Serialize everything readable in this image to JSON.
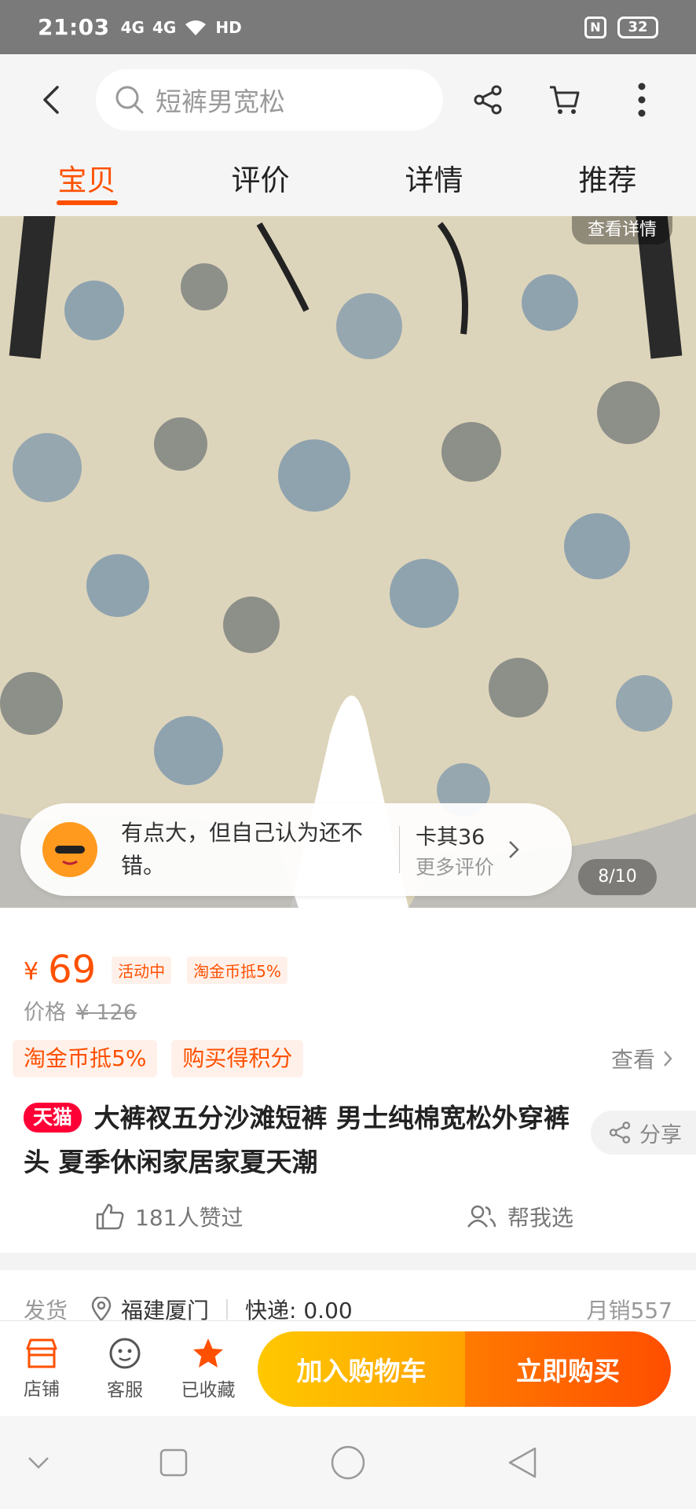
{
  "status_bar": {
    "time": "21:03",
    "signal_1": "4G",
    "signal_2": "4G",
    "hd": "HD",
    "nfc": "N",
    "battery": "32"
  },
  "search": {
    "placeholder": "短裤男宽松"
  },
  "tabs": [
    {
      "label": "宝贝",
      "active": true
    },
    {
      "label": "评价",
      "active": false
    },
    {
      "label": "详情",
      "active": false
    },
    {
      "label": "推荐",
      "active": false
    }
  ],
  "gallery": {
    "view_details": "查看详情",
    "counter": "8/10",
    "colors": {
      "fabric": "#ddd5bb",
      "print_blue": "#4f7aa6",
      "print_dark": "#2d3a4d"
    }
  },
  "review": {
    "text": "有点大，但自己认为还不错。",
    "reviewer": "卡其36",
    "more": "更多评价"
  },
  "price": {
    "currency": "¥",
    "current": "69",
    "tag_active": "活动中",
    "tag_coins": "淘金币抵5%",
    "original_label": "价格",
    "original_value": "¥ 126"
  },
  "promos": {
    "tag1": "淘金币抵5%",
    "tag2": "购买得积分",
    "view": "查看"
  },
  "product": {
    "badge": "天猫",
    "title": "大裤衩五分沙滩短裤 男士纯棉宽松外穿裤头 夏季休闲家居家夏天潮",
    "share": "分享"
  },
  "social": {
    "liked": "181人赞过",
    "help_choose": "帮我选"
  },
  "shipping": {
    "label": "发货",
    "location": "福建厦门",
    "express": "快递: 0.00",
    "monthly_sales": "月销557"
  },
  "actions": {
    "store": "店铺",
    "service": "客服",
    "collected": "已收藏",
    "add_cart": "加入购物车",
    "buy_now": "立即购买"
  },
  "accent": "#ff5000"
}
